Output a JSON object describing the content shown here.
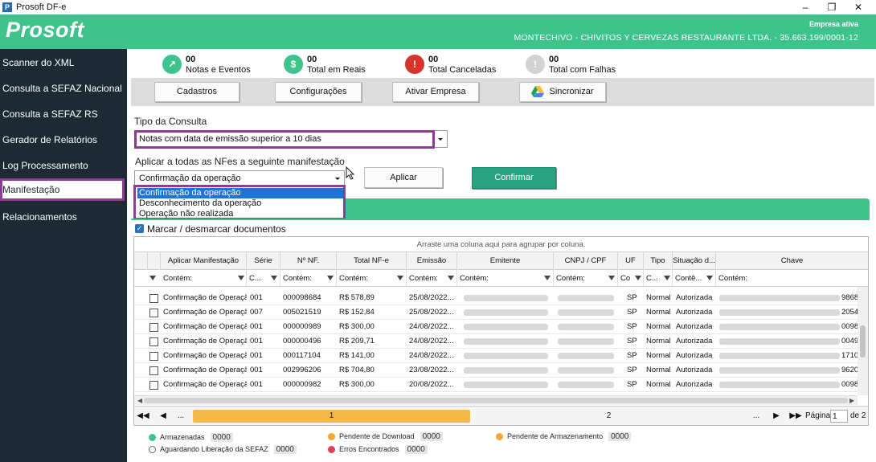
{
  "window": {
    "title": "Prosoft DF-e"
  },
  "header": {
    "logo": "Prosoft",
    "empresa_label": "Empresa ativa",
    "empresa_name": "MONTECHIVO - CHIVITOS Y CERVEZAS RESTAURANTE LTDA. - 35.663.199/0001-12"
  },
  "sidebar": {
    "items": [
      {
        "label": "Scanner do XML"
      },
      {
        "label": "Consulta a SEFAZ Nacional"
      },
      {
        "label": "Consulta a SEFAZ RS"
      },
      {
        "label": "Gerador de Relatórios"
      },
      {
        "label": "Log Processamento"
      },
      {
        "label": "Manifestação",
        "active": true
      },
      {
        "label": "Relacionamentos"
      }
    ]
  },
  "stats": [
    {
      "value": "00",
      "label": "Notas e Eventos",
      "color": "#3fc38d"
    },
    {
      "value": "00",
      "label": "Total em Reais",
      "color": "#3fc38d"
    },
    {
      "value": "00",
      "label": "Total Canceladas",
      "color": "#d9342b"
    },
    {
      "value": "00",
      "label": "Total com Falhas",
      "color": "#c9c9c9"
    }
  ],
  "toolbar": {
    "cadastros": "Cadastros",
    "configuracoes": "Configurações",
    "ativar": "Ativar Empresa",
    "sincronizar": "Sincronizar"
  },
  "form": {
    "tipo_label": "Tipo da Consulta",
    "tipo_value": "Notas com data de emissão superior a 10 dias",
    "aplicar_label": "Aplicar a todas as NFes a seguinte manifestação",
    "manifestacao_value": "Confirmação da operação",
    "options": [
      "Confirmação da operação",
      "Desconhecimento da operação",
      "Operação não realizada"
    ],
    "aplicar_button": "Aplicar",
    "confirmar_button": "Confirmar",
    "marcar_label": "Marcar / desmarcar documentos"
  },
  "grid": {
    "group_hint": "Arraste uma coluna aqui para agrupar por coluna.",
    "columns": [
      "Aplicar Manifestação",
      "Série",
      "Nº NF.",
      "Total NF-e",
      "Emissão",
      "Emitente",
      "CNPJ / CPF",
      "UF",
      "Tipo",
      "Situação d...",
      "Chave"
    ],
    "filters": [
      "Contém:",
      "C...",
      "Contém:",
      "Contém:",
      "Contém:",
      "Contém:",
      "Contém:",
      "Co",
      "C...",
      "Contê...",
      "Contém:"
    ],
    "rows": [
      {
        "manif": "Confirmação de Operação",
        "serie": "001",
        "nf": "000098684",
        "total": "R$ 578,89",
        "emissao": "25/08/2022...",
        "uf": "SP",
        "tipo": "Normal",
        "sit": "Autorizada",
        "chave_end": "9868"
      },
      {
        "manif": "Confirmação de Operação",
        "serie": "007",
        "nf": "005021519",
        "total": "R$ 152,84",
        "emissao": "25/08/2022...",
        "uf": "SP",
        "tipo": "Normal",
        "sit": "Autorizada",
        "chave_end": "2054"
      },
      {
        "manif": "Confirmação de Operação",
        "serie": "001",
        "nf": "000000989",
        "total": "R$ 300,00",
        "emissao": "24/08/2022...",
        "uf": "SP",
        "tipo": "Normal",
        "sit": "Autorizada",
        "chave_end": "0098"
      },
      {
        "manif": "Confirmação de Operação",
        "serie": "001",
        "nf": "000000496",
        "total": "R$ 209,71",
        "emissao": "24/08/2022...",
        "uf": "SP",
        "tipo": "Normal",
        "sit": "Autorizada",
        "chave_end": "0049"
      },
      {
        "manif": "Confirmação de Operação",
        "serie": "001",
        "nf": "000117104",
        "total": "R$ 141,00",
        "emissao": "24/08/2022...",
        "uf": "SP",
        "tipo": "Normal",
        "sit": "Autorizada",
        "chave_end": "1710"
      },
      {
        "manif": "Confirmação de Operação",
        "serie": "001",
        "nf": "002996206",
        "total": "R$ 704,80",
        "emissao": "23/08/2022...",
        "uf": "SP",
        "tipo": "Normal",
        "sit": "Autorizada",
        "chave_end": "9620"
      },
      {
        "manif": "Confirmação de Operação",
        "serie": "001",
        "nf": "000000982",
        "total": "R$ 300,00",
        "emissao": "20/08/2022...",
        "uf": "SP",
        "tipo": "Normal",
        "sit": "Autorizada",
        "chave_end": "0098"
      }
    ],
    "pager": {
      "page1": "1",
      "page2": "2",
      "ellipsis": "...",
      "pagina_label": "Página",
      "pagina_value": "1",
      "de_label": "de 2"
    }
  },
  "legend": [
    {
      "label": "Armazenadas",
      "count": "0000",
      "color": "#3fc38d"
    },
    {
      "label": "Pendente de Download",
      "count": "0000",
      "color": "#f0a830"
    },
    {
      "label": "Pendente de Armazenamento",
      "count": "0000",
      "color": "#f0a830"
    },
    {
      "label": "Aguardando Liberação da SEFAZ",
      "count": "0000",
      "color": "#ffffff"
    },
    {
      "label": "Erros Encontrados",
      "count": "0000",
      "color": "#e0405a"
    }
  ]
}
